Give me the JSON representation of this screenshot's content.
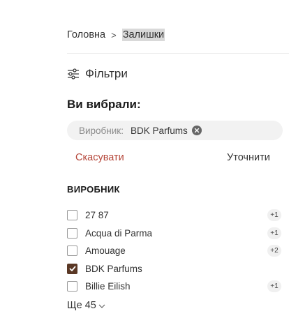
{
  "breadcrumb": {
    "home": "Головна",
    "separator": ">",
    "current": "Залишки"
  },
  "filters": {
    "title": "Фільтри",
    "icon": "sliders-icon"
  },
  "selected": {
    "title": "Ви вибрали:",
    "chip": {
      "label": "Виробник:",
      "value": "BDK Parfums",
      "remove_icon": "close-circle-icon"
    },
    "cancel_label": "Скасувати",
    "refine_label": "Уточнити"
  },
  "manufacturer": {
    "title": "ВИРОБНИК",
    "options": [
      {
        "label": "27 87",
        "count": "+1",
        "checked": false
      },
      {
        "label": "Acqua di Parma",
        "count": "+1",
        "checked": false
      },
      {
        "label": "Amouage",
        "count": "+2",
        "checked": false
      },
      {
        "label": "BDK Parfums",
        "count": "",
        "checked": true
      },
      {
        "label": "Billie Eilish",
        "count": "+1",
        "checked": false
      }
    ],
    "more_label": "Ще 45"
  },
  "colors": {
    "accent": "#5a3825",
    "cancel": "#b5473a"
  }
}
